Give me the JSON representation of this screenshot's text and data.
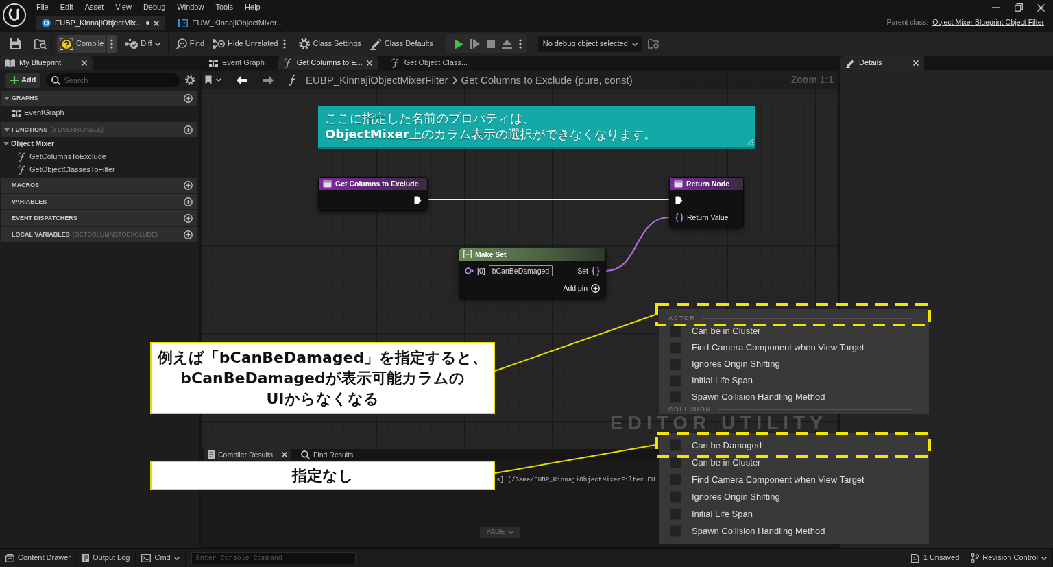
{
  "menu_bar": [
    "File",
    "Edit",
    "Asset",
    "View",
    "Debug",
    "Window",
    "Tools",
    "Help"
  ],
  "document_tabs": [
    {
      "label": "EUBP_KinnajiObjectMix...",
      "kind": "utility_blueprint",
      "selected": true,
      "unsaved": true
    },
    {
      "label": "EUW_KinnajiObjectMixer...",
      "kind": "widget_blueprint",
      "selected": false,
      "unsaved": false
    }
  ],
  "parent_class": {
    "label": "Parent class:",
    "link": "Object Mixer Blueprint Object Filter"
  },
  "toolbar": {
    "compile": "Compile",
    "diff": "Diff",
    "find": "Find",
    "hide_unrelated": "Hide Unrelated",
    "class_settings": "Class Settings",
    "class_defaults": "Class Defaults",
    "debug_object": "No debug object selected"
  },
  "my_blueprint": {
    "tab": "My Blueprint",
    "add": "Add",
    "search": {
      "placeholder": "Search"
    },
    "sections": [
      {
        "title": "GRAPHS",
        "expanded": true,
        "children": [
          {
            "label": "EventGraph",
            "kind": "graph"
          }
        ]
      },
      {
        "title": "FUNCTIONS",
        "note": "(8 OVERRIDABLE)",
        "expanded": true,
        "children": [
          {
            "label": "Object Mixer",
            "kind": "category",
            "expanded": true,
            "children": [
              {
                "label": "GetColumnsToExclude",
                "kind": "function"
              },
              {
                "label": "GetObjectClassesToFilter",
                "kind": "function"
              }
            ]
          }
        ]
      },
      {
        "title": "MACROS"
      },
      {
        "title": "VARIABLES"
      },
      {
        "title": "EVENT DISPATCHERS"
      },
      {
        "title": "LOCAL VARIABLES",
        "note": "(GETCOLUMNSTOEXCLUDE)"
      }
    ]
  },
  "graph_tabs": [
    {
      "label": "Event Graph",
      "kind": "event_graph",
      "selected": false
    },
    {
      "label": "Get Columns to E...",
      "kind": "function",
      "selected": true
    },
    {
      "label": "Get Object Class...",
      "kind": "function",
      "selected": false
    }
  ],
  "breadcrumb": {
    "blueprint": "EUBP_KinnajiObjectMixerFilter",
    "graph": "Get Columns to Exclude (pure, const)"
  },
  "zoom_label": "Zoom 1:1",
  "graph": {
    "comment": "ここに指定した名前のプロパティは、\n**ObjectMixer**上のカラム表示の選択ができなくなります。",
    "nodes": [
      {
        "kind": "function_entry",
        "title": "Get Columns to Exclude"
      },
      {
        "kind": "function_result",
        "title": "Return Node",
        "pin_label": "Return Value"
      },
      {
        "kind": "make_set",
        "title": "Make Set",
        "index_label": "[0]",
        "value": "bCanBeDamaged",
        "output_label": "Set",
        "add_pin": "Add pin"
      }
    ],
    "wires": [
      {
        "kind": "exec"
      },
      {
        "kind": "set"
      }
    ],
    "type_label": "EDITOR UTILITY"
  },
  "bottom_tabs": [
    {
      "label": "Compiler Results",
      "kind": "compiler",
      "selected": true
    },
    {
      "label": "Find Results",
      "kind": "find",
      "selected": false
    }
  ],
  "compiler_log": "s] (/Game/EUBP_KinnajiObjectMixerFilter.EU",
  "page_button": "PAGE",
  "details": {
    "tab": "Details"
  },
  "status_bar": {
    "content_drawer": "Content Drawer",
    "output_log": "Output Log",
    "cmd": "Cmd",
    "console": {
      "placeholder": "Enter Console Command"
    },
    "unsaved": "1 Unsaved",
    "revision_control": "Revision Control"
  },
  "column_pickers": [
    {
      "rows": [
        {
          "kind": "header",
          "label": "ACTOR"
        },
        {
          "kind": "option",
          "label": "Can be in Cluster",
          "checked": false
        },
        {
          "kind": "option",
          "label": "Find Camera Component when View Target",
          "checked": false
        },
        {
          "kind": "option",
          "label": "Ignores Origin Shifting",
          "checked": false
        },
        {
          "kind": "option",
          "label": "Initial Life Span",
          "checked": false
        },
        {
          "kind": "option",
          "label": "Spawn Collision Handling Method",
          "checked": false
        },
        {
          "kind": "header",
          "label": "COLLISION"
        }
      ]
    },
    {
      "rows": [
        {
          "kind": "option",
          "label": "Can be Damaged",
          "checked": false
        },
        {
          "kind": "option",
          "label": "Can be in Cluster",
          "checked": false
        },
        {
          "kind": "option",
          "label": "Find Camera Component when View Target",
          "checked": false
        },
        {
          "kind": "option",
          "label": "Ignores Origin Shifting",
          "checked": false
        },
        {
          "kind": "option",
          "label": "Initial Life Span",
          "checked": false
        },
        {
          "kind": "option",
          "label": "Spawn Collision Handling Method",
          "checked": false
        }
      ]
    }
  ],
  "callouts": [
    {
      "text": "例えば「bCanBeDamaged」を指定すると、\nbCanBeDamagedが表示可能カラムの\nUIからなくなる"
    },
    {
      "text": "指定なし"
    }
  ]
}
